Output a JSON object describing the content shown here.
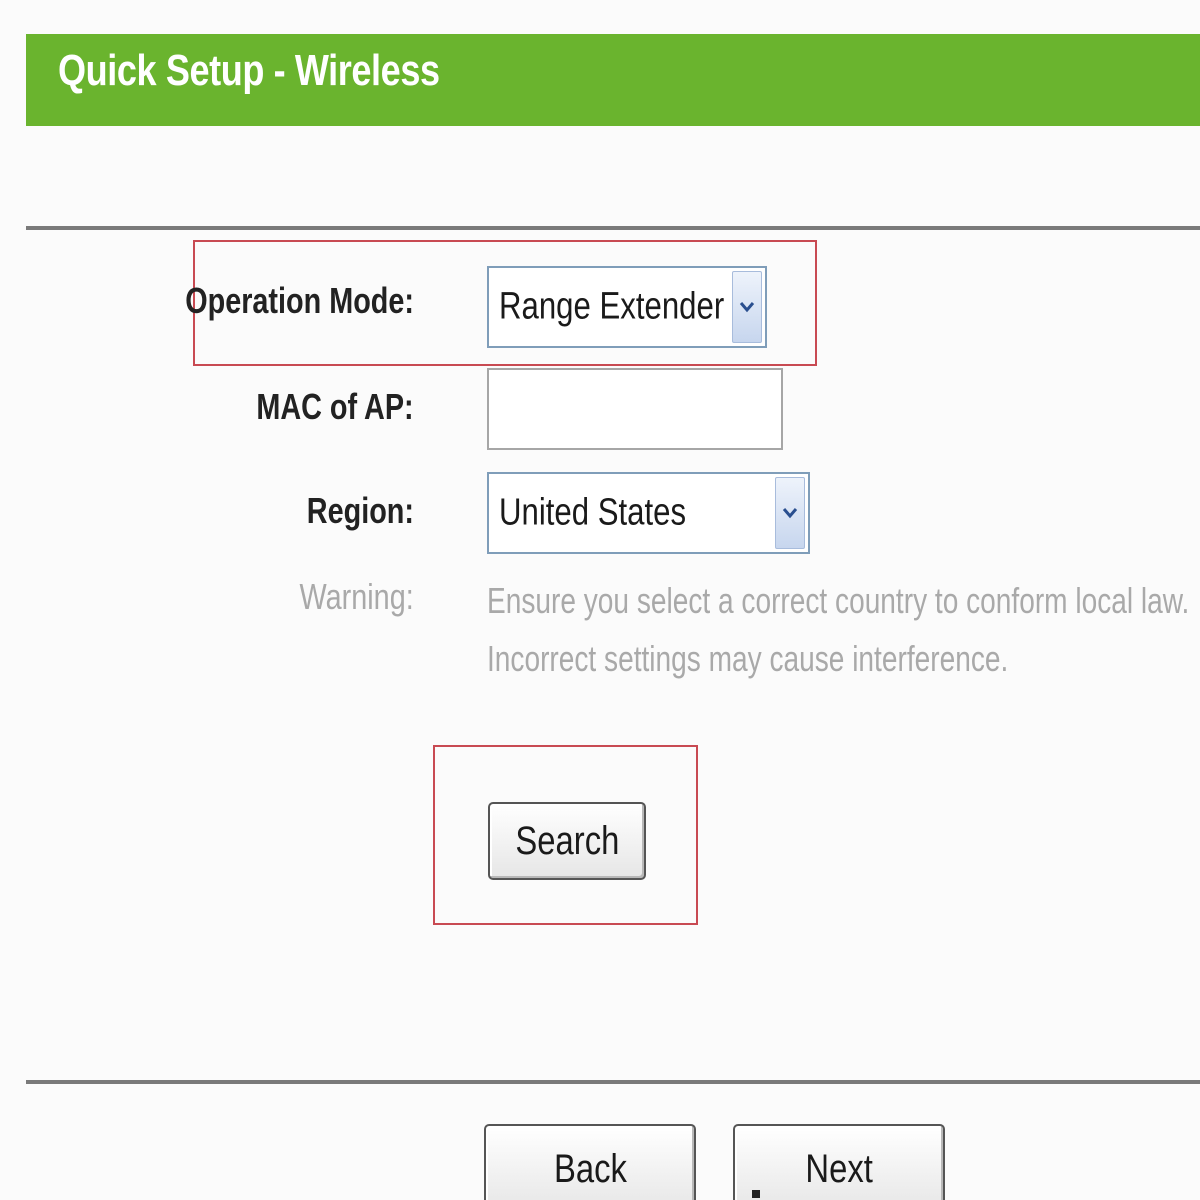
{
  "header": {
    "title": "Quick Setup - Wireless",
    "bar_color": "#6ab42e"
  },
  "form": {
    "operation_mode": {
      "label": "Operation Mode:",
      "selected": "Range Extender"
    },
    "mac_of_ap": {
      "label": "MAC of AP:",
      "value": ""
    },
    "region": {
      "label": "Region:",
      "selected": "United States"
    },
    "warning": {
      "label": "Warning:",
      "line1": "Ensure you select a correct country to conform local law.",
      "line2": "Incorrect settings may cause interference."
    }
  },
  "buttons": {
    "search": "Search",
    "back": "Back",
    "next": "Next"
  },
  "icons": {
    "dropdown": "chevron-down-icon"
  },
  "colors": {
    "highlight": "#c84a52",
    "warning_text": "#a9a9a9"
  }
}
